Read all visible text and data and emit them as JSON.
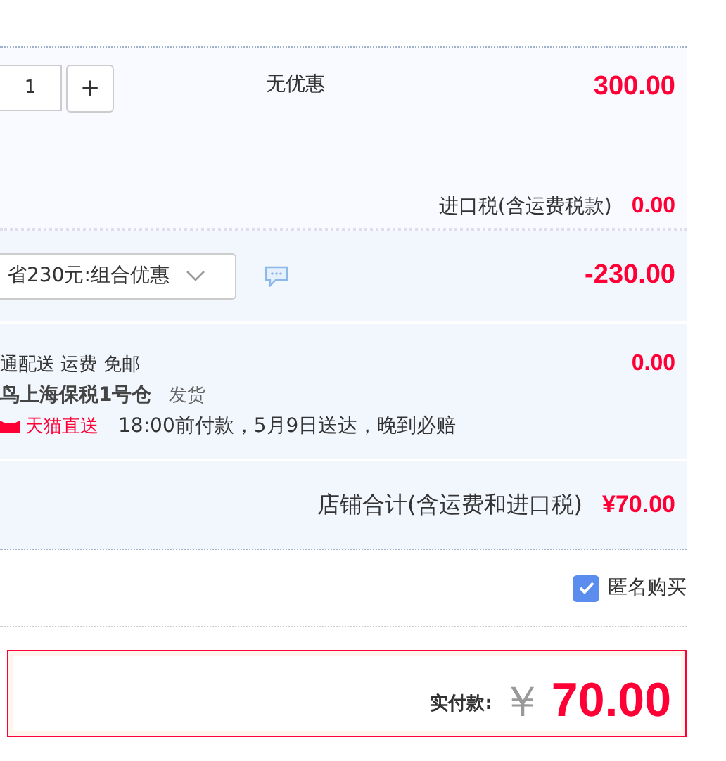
{
  "item": {
    "quantity": "1",
    "plus": "+",
    "promotion": "无优惠",
    "price": "300.00",
    "tax_label": "进口税(含运费税款)",
    "tax": "0.00"
  },
  "discount": {
    "option": "省230元:组合优惠",
    "amount": "-230.00"
  },
  "shipping": {
    "method": "通配送 运费 免邮",
    "fee": "0.00",
    "warehouse": "鸟上海保税1号仓",
    "warehouse_suffix": "发货",
    "service": "天猫直送",
    "promise": "18:00前付款，5月9日送达，晚到必赔"
  },
  "shop_total": {
    "label": "店铺合计(含运费和进口税)",
    "amount": "¥70.00"
  },
  "anonymous": {
    "label": "匿名购买",
    "checked": true
  },
  "payment": {
    "label": "实付款:",
    "currency": "￥",
    "amount": "70.00"
  }
}
